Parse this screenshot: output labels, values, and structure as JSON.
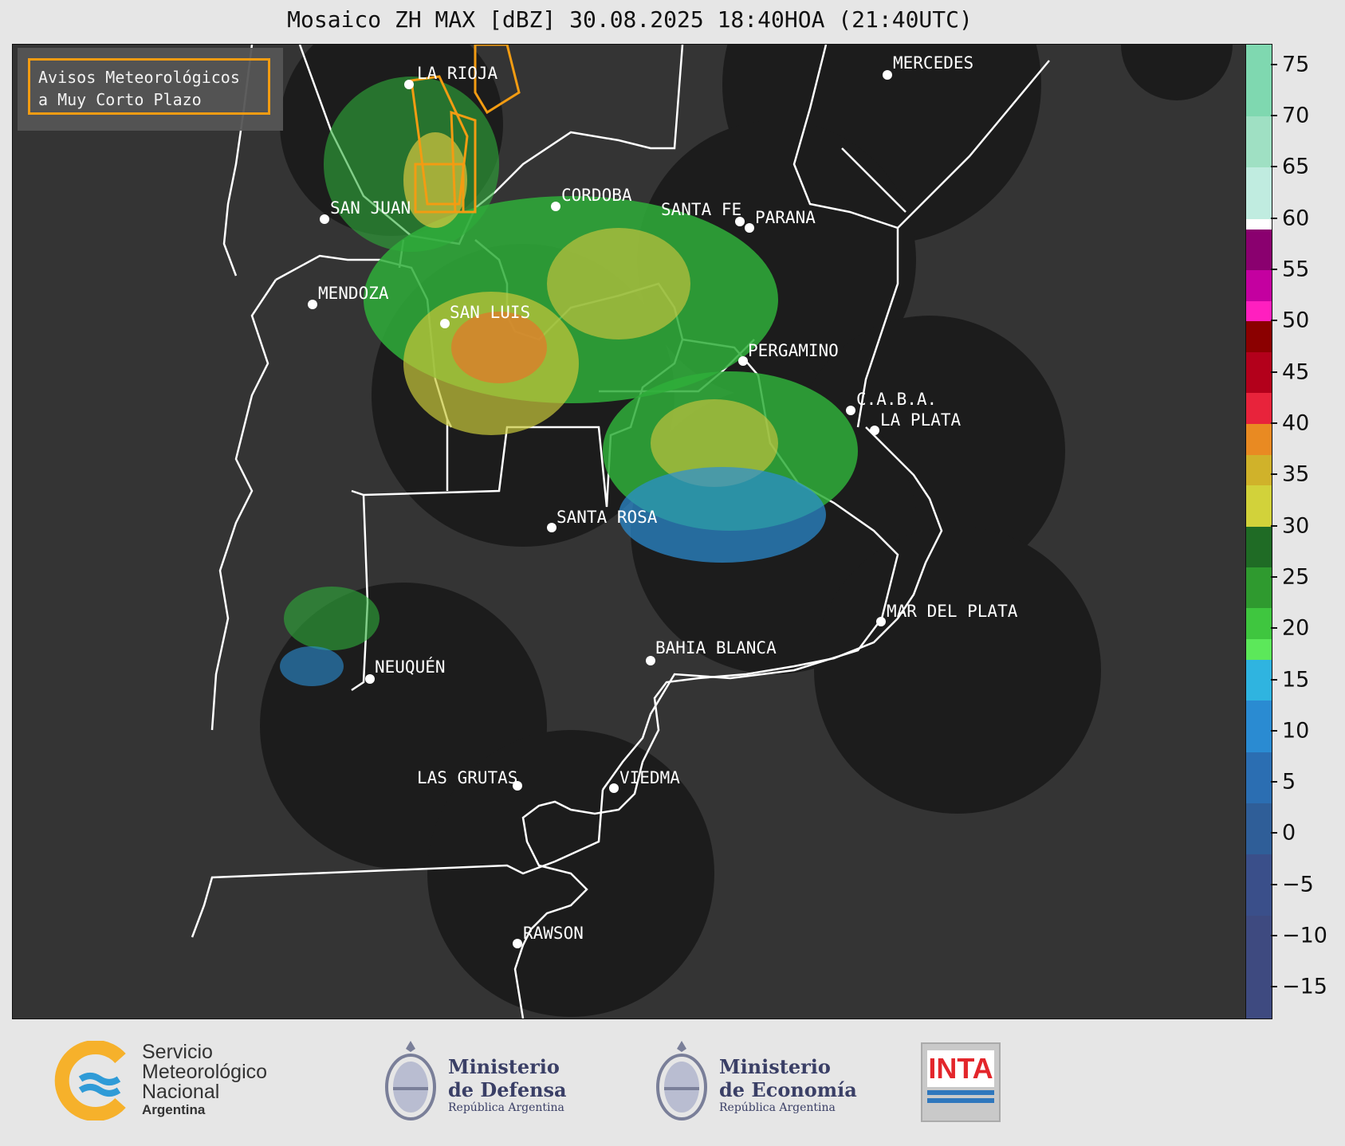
{
  "title": "Mosaico ZH MAX [dBZ] 30.08.2025 18:40HOA (21:40UTC)",
  "warning_box": {
    "line1": "Avisos Meteorológicos",
    "line2": "a Muy Corto Plazo",
    "border_color": "#f39c12"
  },
  "cities": [
    {
      "name": "LA RIOJA"
    },
    {
      "name": "MERCEDES"
    },
    {
      "name": "SAN JUAN"
    },
    {
      "name": "CORDOBA"
    },
    {
      "name": "SANTA FE"
    },
    {
      "name": "PARANA"
    },
    {
      "name": "MENDOZA"
    },
    {
      "name": "SAN LUIS"
    },
    {
      "name": "PERGAMINO"
    },
    {
      "name": "C.A.B.A."
    },
    {
      "name": "LA PLATA"
    },
    {
      "name": "SANTA ROSA"
    },
    {
      "name": "MAR DEL PLATA"
    },
    {
      "name": "BAHIA BLANCA"
    },
    {
      "name": "NEUQUÉN"
    },
    {
      "name": "LAS GRUTAS"
    },
    {
      "name": "VIEDMA"
    },
    {
      "name": "RAWSON"
    }
  ],
  "colorbar": {
    "unit": "dBZ",
    "range": [
      -18,
      77
    ],
    "tick_labels": [
      "75",
      "70",
      "65",
      "60",
      "55",
      "50",
      "45",
      "40",
      "35",
      "30",
      "25",
      "20",
      "15",
      "10",
      "5",
      "0",
      "−5",
      "−10",
      "−15"
    ],
    "tick_values": [
      75,
      70,
      65,
      60,
      55,
      50,
      45,
      40,
      35,
      30,
      25,
      20,
      15,
      10,
      5,
      0,
      -5,
      -10,
      -15
    ]
  },
  "logos": {
    "smn": {
      "line1": "Servicio",
      "line2": "Meteorológico",
      "line3": "Nacional",
      "line4": "Argentina"
    },
    "defensa": {
      "line1": "Ministerio",
      "line2": "de Defensa",
      "line3": "República Argentina"
    },
    "economia": {
      "line1": "Ministerio",
      "line2": "de Economía",
      "line3": "República Argentina"
    },
    "inta": {
      "text": "INTA"
    }
  }
}
